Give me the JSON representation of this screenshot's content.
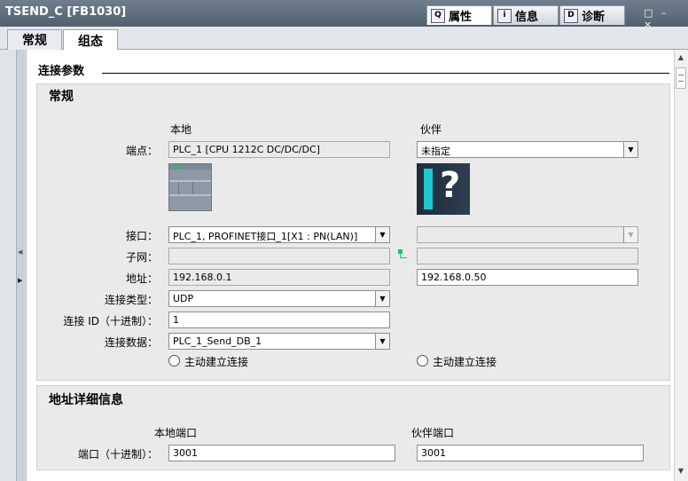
{
  "window": {
    "title": "TSEND_C [FB1030]",
    "controls": "□ – ×"
  },
  "inspector_tabs": [
    {
      "label": "属性",
      "icon": "properties-icon",
      "glyph": "Q"
    },
    {
      "label": "信息",
      "icon": "info-icon",
      "glyph": "i"
    },
    {
      "label": "诊断",
      "icon": "diagnostics-icon",
      "glyph": "D"
    }
  ],
  "sub_tabs": [
    "常规",
    "组态"
  ],
  "section_title": "连接参数",
  "general": {
    "title": "常规",
    "local_header": "本地",
    "partner_header": "伙伴",
    "labels": {
      "endpoint": "端点：",
      "interface": "接口：",
      "subnet": "子网：",
      "address": "地址：",
      "conn_type": "连接类型：",
      "conn_id": "连接 ID（十进制）：",
      "conn_data": "连接数据："
    },
    "local": {
      "endpoint": "PLC_1 [CPU 1212C DC/DC/DC]",
      "interface": "PLC_1, PROFINET接口_1[X1 : PN(LAN)]",
      "subnet": "",
      "address": "192.168.0.1",
      "conn_type": "UDP",
      "conn_id": "1",
      "conn_data": "PLC_1_Send_DB_1",
      "active_label": "主动建立连接"
    },
    "partner": {
      "endpoint": "未指定",
      "interface": "",
      "subnet": "",
      "address": "192.168.0.50",
      "active_label": "主动建立连接",
      "unknown_glyph": "?"
    }
  },
  "address_details": {
    "title": "地址详细信息",
    "local_port_header": "本地端口",
    "partner_port_header": "伙伴端口",
    "port_label": "端口（十进制）：",
    "local_port": "3001",
    "partner_port": "3001"
  },
  "scrollbar": {
    "up": "▲",
    "down": "▼"
  },
  "colors": {
    "accent_green": "#17c564",
    "title_bar": "#5a6876",
    "panel": "#eaeaea"
  }
}
